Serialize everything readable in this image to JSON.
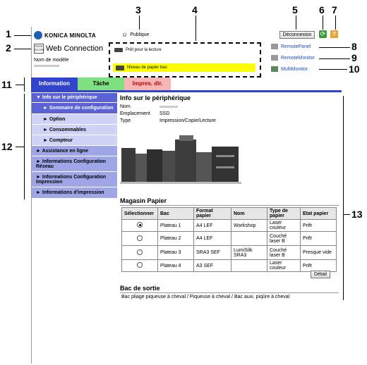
{
  "callouts": {
    "n1": "1",
    "n2": "2",
    "n3": "3",
    "n4": "4",
    "n5": "5",
    "n6": "6",
    "n7": "7",
    "n8": "8",
    "n9": "9",
    "n10": "10",
    "n11": "11",
    "n12": "12",
    "n13": "13"
  },
  "header": {
    "brand": "KONICA MINOLTA",
    "pagescope_line1": "PAGE",
    "pagescope_line2": "SCOPE",
    "webconnection": "Web Connection",
    "model_label": "Nom de modèle",
    "user": "Publique",
    "logout": "Déconnexion",
    "status_ready": "Prêt pour la lecture",
    "status_paper": "Niveau de papier bas",
    "links": [
      "RemotePanel",
      "RemoteMonitor",
      "MultiMonitor"
    ]
  },
  "tabs": [
    "Information",
    "Tâche",
    "Impres. dir."
  ],
  "sidebar": {
    "items": [
      {
        "label": "▼ Info sur le périphérique"
      },
      {
        "label": "► Sommaire de configuration"
      },
      {
        "label": "► Option"
      },
      {
        "label": "► Consommables"
      },
      {
        "label": "► Compteur"
      },
      {
        "label": "► Assistance en ligne"
      },
      {
        "label": "► Informations Configuration Réseau"
      },
      {
        "label": "► Informations Configuration Impression"
      },
      {
        "label": "► Informations d'impression"
      }
    ]
  },
  "main": {
    "title": "Info sur le périphérique",
    "fields": [
      {
        "label": "Nom",
        "value": ""
      },
      {
        "label": "Emplacement",
        "value": "SSD"
      },
      {
        "label": "Type",
        "value": "Impression/Copie/Lecture"
      }
    ],
    "tray_title": "Magasin Papier",
    "tray_headers": [
      "Sélectionner",
      "Bac",
      "Format papier",
      "Nom",
      "Type de papier",
      "Etat papier"
    ],
    "tray_rows": [
      {
        "bac": "Plateau 1",
        "format": "A4 LEF",
        "nom": "Workshop",
        "type": "Laser couleur",
        "etat": "Prêt",
        "selected": true
      },
      {
        "bac": "Plateau 2",
        "format": "A4 LEF",
        "nom": "",
        "type": "Couché laser B",
        "etat": "Prêt",
        "selected": false
      },
      {
        "bac": "Plateau 3",
        "format": "SRA3 SEF",
        "nom": "LumiSilk SRA3",
        "type": "Couché laser B",
        "etat": "Presque vide",
        "selected": false
      },
      {
        "bac": "Plateau 4",
        "format": "A3 SEF",
        "nom": "",
        "type": "Laser couleur",
        "etat": "Prêt",
        "selected": false
      }
    ],
    "detail_button": "Détail",
    "output_title": "Bac de sortie",
    "output_text": "Bac pliage piqueuse à cheval / Piqueuse à cheval / Bac auxi. piqûre à cheval"
  },
  "colors": {
    "tab_information": "#3344cc",
    "tab_tache": "#7ee07e",
    "tab_impres": "#f6b6b6",
    "paper_warning": "#ffff00"
  }
}
